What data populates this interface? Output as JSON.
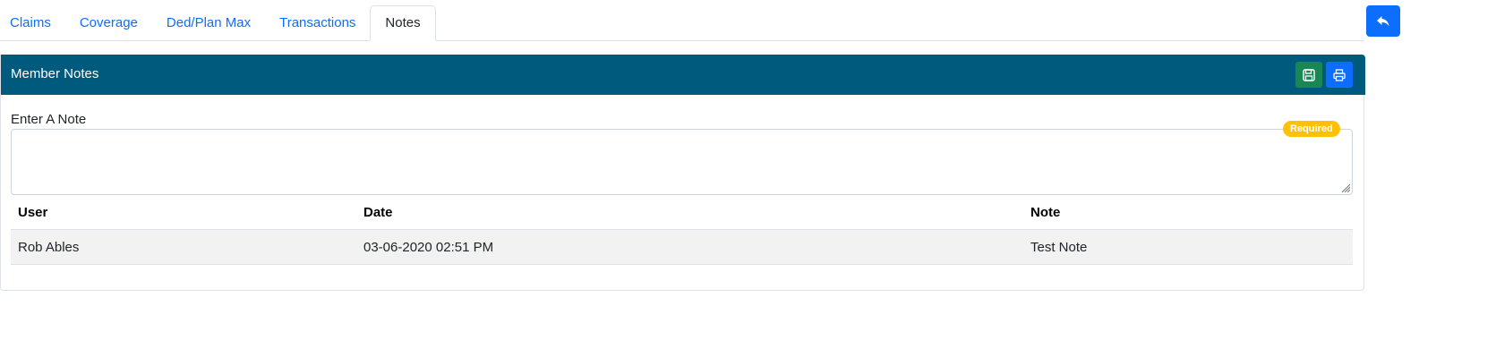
{
  "tabs": [
    {
      "label": "Claims",
      "active": false
    },
    {
      "label": "Coverage",
      "active": false
    },
    {
      "label": "Ded/Plan Max",
      "active": false
    },
    {
      "label": "Transactions",
      "active": false
    },
    {
      "label": "Notes",
      "active": true
    }
  ],
  "back_button": {
    "icon": "reply-icon",
    "color": "#0d6efd"
  },
  "panel": {
    "title": "Member Notes",
    "header_color": "#005a7d",
    "save_button": {
      "icon": "save-icon",
      "color": "#198754"
    },
    "print_button": {
      "icon": "print-icon",
      "color": "#0d6efd"
    }
  },
  "note_form": {
    "label": "Enter A Note",
    "value": "",
    "placeholder": "",
    "badge": "Required",
    "badge_color": "#ffc107"
  },
  "table": {
    "columns": [
      "User",
      "Date",
      "Note"
    ],
    "rows": [
      {
        "user": "Rob Ables",
        "date": "03-06-2020 02:51 PM",
        "note": "Test Note"
      }
    ]
  }
}
